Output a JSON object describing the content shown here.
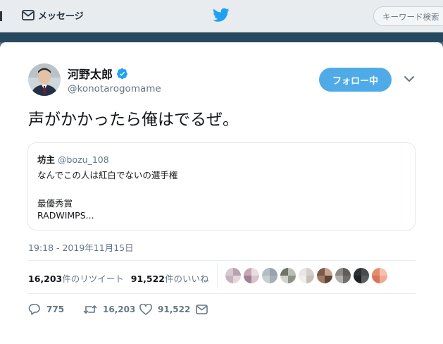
{
  "nav": {
    "messages_label": "メッセージ",
    "search_placeholder": "キーワード検索"
  },
  "tweet": {
    "author_name": "河野太郎",
    "author_handle": "@konotarogomame",
    "verified": true,
    "follow_label": "フォロー中",
    "text": "声がかかったら俺はでるぜ。",
    "timestamp": "19:18 - 2019年11月15日",
    "quoted": {
      "name": "坊主",
      "handle": "@bozu_108",
      "lines": [
        "なんでこの人は紅白でないの選手権",
        "",
        "最優秀賞",
        "RADWIMPS..."
      ]
    },
    "retweets_count": "16,203",
    "retweets_suffix": "件のリツイート",
    "likes_count": "91,522",
    "likes_suffix": "件のいいね",
    "actions": {
      "replies": "775",
      "retweets": "16,203",
      "likes": "91,522"
    }
  },
  "colors": {
    "accent": "#1da1f2",
    "follow_button": "#4fabe8",
    "text": "#14171a",
    "secondary": "#657786"
  },
  "icons": [
    "envelope-icon",
    "bird-logo-icon",
    "verified-badge-icon",
    "chevron-down-icon",
    "reply-icon",
    "retweet-icon",
    "heart-icon",
    "direct-message-icon"
  ]
}
